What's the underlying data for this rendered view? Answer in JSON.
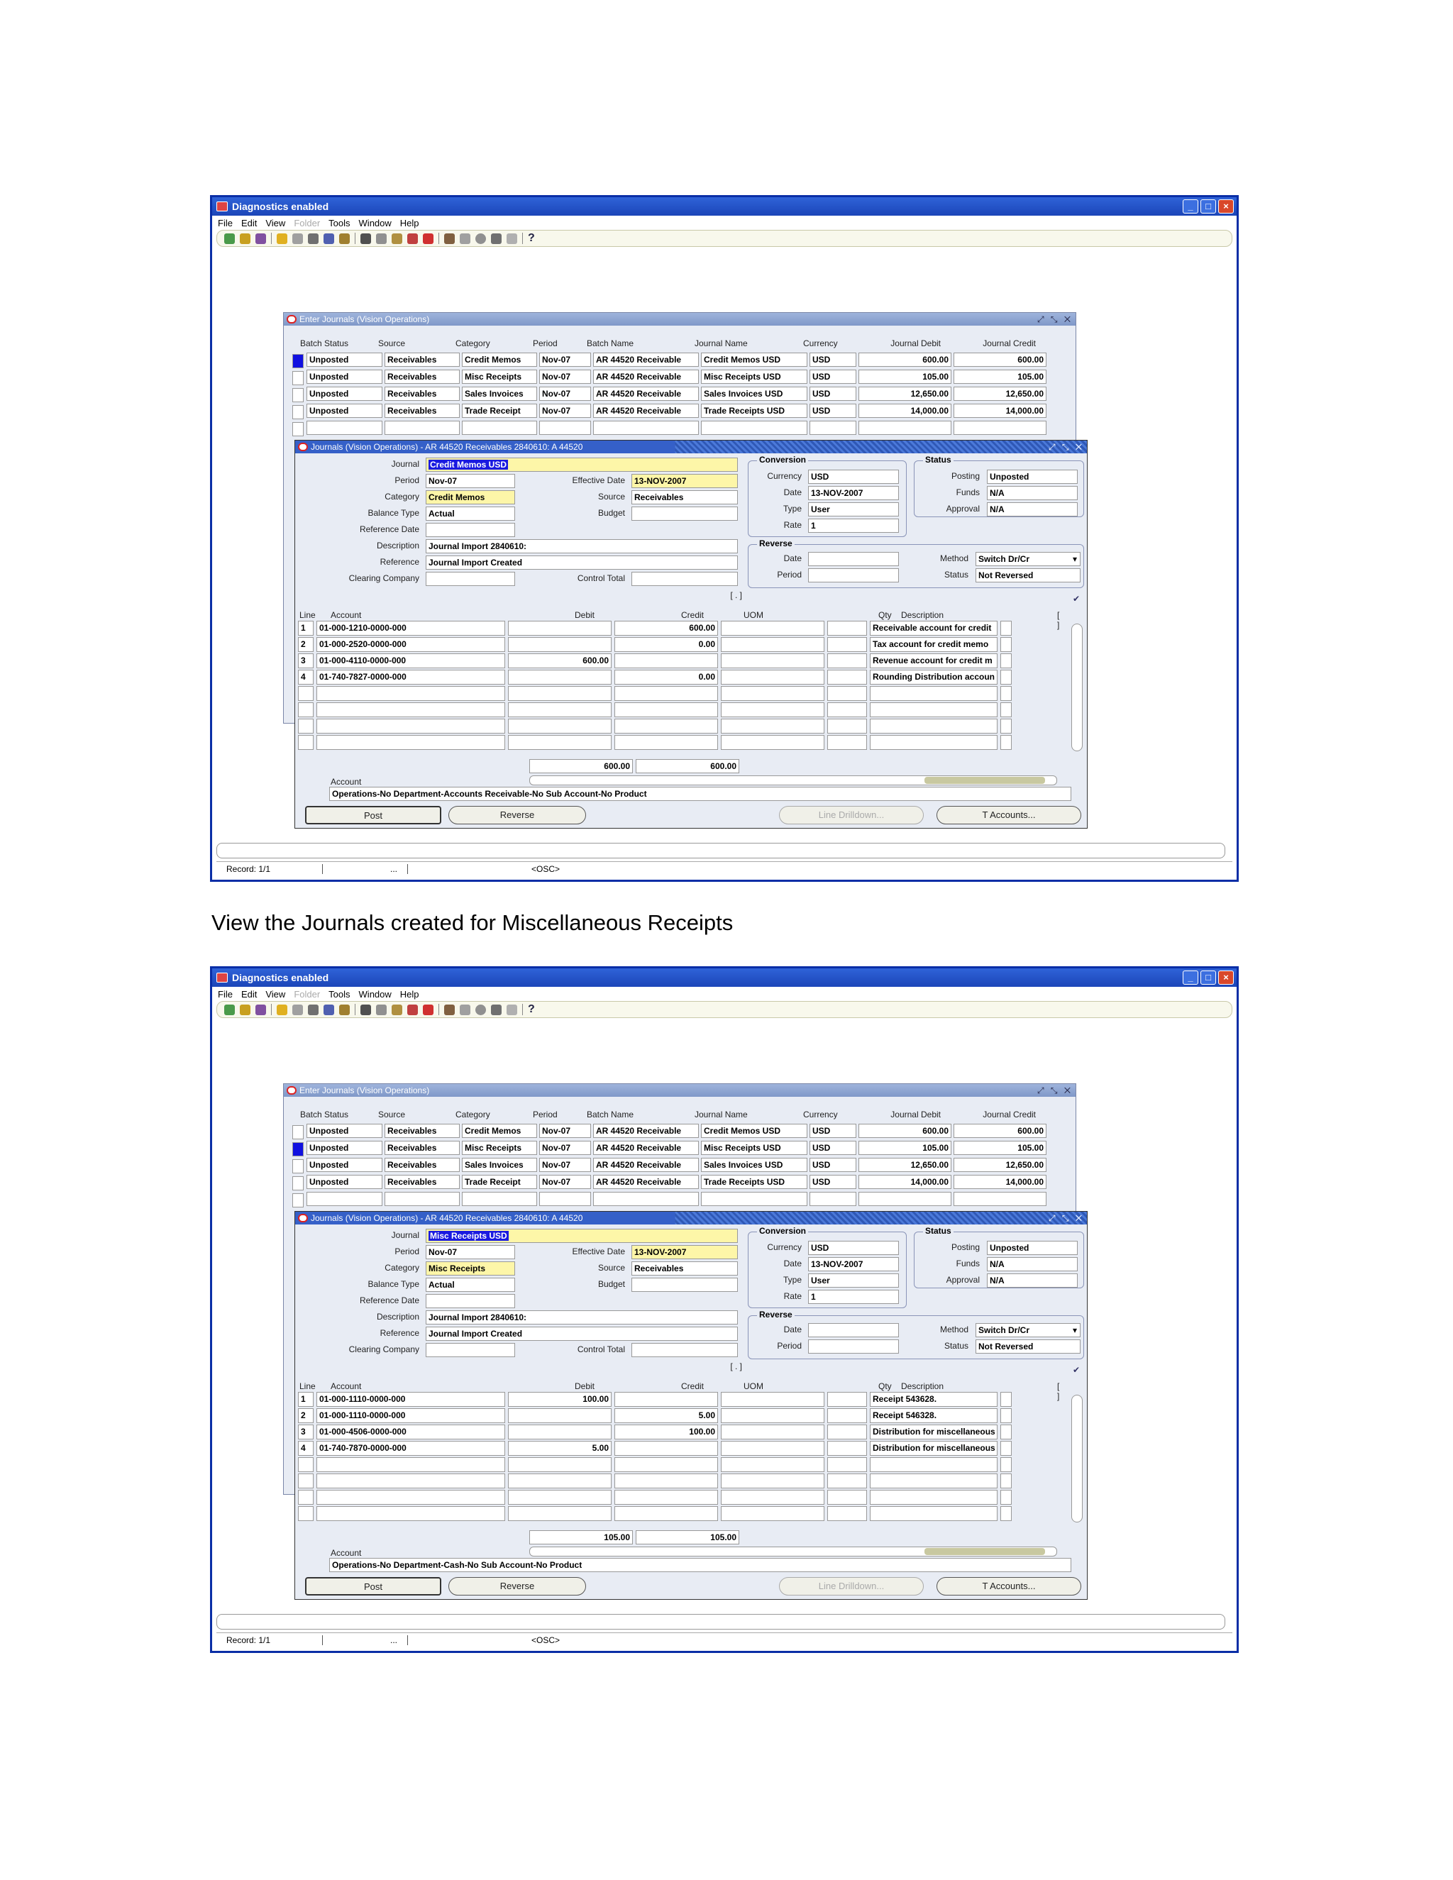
{
  "caption": "View the Journals created for Miscellaneous Receipts",
  "app": {
    "title": "Diagnostics enabled",
    "menu": [
      "File",
      "Edit",
      "View",
      "Folder",
      "Tools",
      "Window",
      "Help"
    ],
    "help_glyph": "?",
    "status": {
      "record": "Record: 1/1",
      "ellipsis": "...",
      "osc": "<OSC>"
    }
  },
  "enter_journals": {
    "title": "Enter Journals (Vision Operations)",
    "headers": [
      "Batch Status",
      "Source",
      "Category",
      "Period",
      "Batch Name",
      "Journal Name",
      "Currency",
      "Journal Debit",
      "Journal Credit"
    ],
    "rows": [
      [
        "Unposted",
        "Receivables",
        "Credit Memos",
        "Nov-07",
        "AR 44520 Receivable",
        "Credit Memos USD",
        "USD",
        "600.00",
        "600.00"
      ],
      [
        "Unposted",
        "Receivables",
        "Misc Receipts",
        "Nov-07",
        "AR 44520 Receivable",
        "Misc Receipts USD",
        "USD",
        "105.00",
        "105.00"
      ],
      [
        "Unposted",
        "Receivables",
        "Sales Invoices",
        "Nov-07",
        "AR 44520 Receivable",
        "Sales Invoices USD",
        "USD",
        "12,650.00",
        "12,650.00"
      ],
      [
        "Unposted",
        "Receivables",
        "Trade Receipt",
        "Nov-07",
        "AR 44520 Receivable",
        "Trade Receipts USD",
        "USD",
        "14,000.00",
        "14,000.00"
      ]
    ]
  },
  "journals_labels": {
    "title": "Journals (Vision Operations) - AR 44520 Receivables 2840610: A 44520",
    "journal": "Journal",
    "period": "Period",
    "category": "Category",
    "balance_type": "Balance Type",
    "reference_date": "Reference Date",
    "description": "Description",
    "reference": "Reference",
    "clearing_company": "Clearing Company",
    "effective_date": "Effective Date",
    "source": "Source",
    "budget": "Budget",
    "control_total": "Control Total",
    "conversion": "Conversion",
    "currency": "Currency",
    "date": "Date",
    "type": "Type",
    "rate": "Rate",
    "status": "Status",
    "posting": "Posting",
    "funds": "Funds",
    "approval": "Approval",
    "reverse": "Reverse",
    "rev_date": "Date",
    "rev_period": "Period",
    "method": "Method",
    "rev_status": "Status",
    "dff": "[ . ]",
    "line_headers": [
      "Line",
      "Account",
      "Debit (USD)",
      "Credit (USD)",
      "UOM",
      "Qty",
      "Description"
    ],
    "line_dff": "[ ]",
    "account_description": "Account Description",
    "buttons": {
      "post": "Post",
      "reverse": "Reverse",
      "line_drilldown": "Line Drilldown...",
      "t_accounts": "T Accounts..."
    }
  },
  "screens": [
    {
      "selected_row": 0,
      "journal": "Credit Memos USD",
      "period": "Nov-07",
      "category": "Credit Memos",
      "balance_type": "Actual",
      "description": "Journal Import 2840610:",
      "reference": "Journal Import Created",
      "effective_date": "13-NOV-2007",
      "source": "Receivables",
      "conv_currency": "USD",
      "conv_date": "13-NOV-2007",
      "conv_type": "User",
      "conv_rate": "1",
      "posting": "Unposted",
      "funds": "N/A",
      "approval": "N/A",
      "method": "Switch Dr/Cr",
      "rev_status": "Not Reversed",
      "lines": [
        {
          "line": "1",
          "account": "01-000-1210-0000-000",
          "debit": "",
          "credit": "600.00",
          "desc": "Receivable account for credit"
        },
        {
          "line": "2",
          "account": "01-000-2520-0000-000",
          "debit": "",
          "credit": "0.00",
          "desc": "Tax account for credit memo"
        },
        {
          "line": "3",
          "account": "01-000-4110-0000-000",
          "debit": "600.00",
          "credit": "",
          "desc": "Revenue account for credit m"
        },
        {
          "line": "4",
          "account": "01-740-7827-0000-000",
          "debit": "",
          "credit": "0.00",
          "desc": "Rounding Distribution accoun"
        }
      ],
      "total_debit": "600.00",
      "total_credit": "600.00",
      "account_desc": "Operations-No Department-Accounts Receivable-No Sub Account-No Product"
    },
    {
      "selected_row": 1,
      "journal": "Misc Receipts USD",
      "period": "Nov-07",
      "category": "Misc Receipts",
      "balance_type": "Actual",
      "description": "Journal Import 2840610:",
      "reference": "Journal Import Created",
      "effective_date": "13-NOV-2007",
      "source": "Receivables",
      "conv_currency": "USD",
      "conv_date": "13-NOV-2007",
      "conv_type": "User",
      "conv_rate": "1",
      "posting": "Unposted",
      "funds": "N/A",
      "approval": "N/A",
      "method": "Switch Dr/Cr",
      "rev_status": "Not Reversed",
      "lines": [
        {
          "line": "1",
          "account": "01-000-1110-0000-000",
          "debit": "100.00",
          "credit": "",
          "desc": "Receipt 543628."
        },
        {
          "line": "2",
          "account": "01-000-1110-0000-000",
          "debit": "",
          "credit": "5.00",
          "desc": "Receipt 546328."
        },
        {
          "line": "3",
          "account": "01-000-4506-0000-000",
          "debit": "",
          "credit": "100.00",
          "desc": "Distribution for miscellaneous"
        },
        {
          "line": "4",
          "account": "01-740-7870-0000-000",
          "debit": "5.00",
          "credit": "",
          "desc": "Distribution for miscellaneous"
        }
      ],
      "total_debit": "105.00",
      "total_credit": "105.00",
      "account_desc": "Operations-No Department-Cash-No Sub Account-No Product"
    }
  ]
}
